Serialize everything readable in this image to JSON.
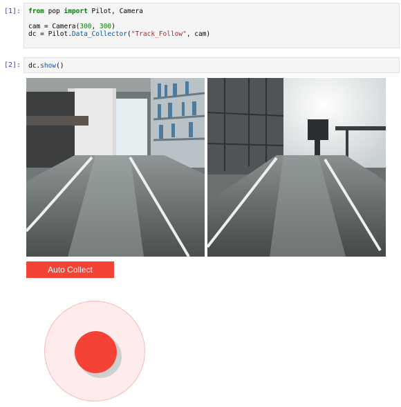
{
  "cells": [
    {
      "prompt": "[1]:",
      "code": {
        "line1": {
          "kw_from": "from",
          "mod": " pop ",
          "kw_import": "import",
          "names": " Pilot, Camera"
        },
        "line2": "",
        "line3": {
          "pre": "cam = Camera(",
          "n1": "300",
          "sep": ", ",
          "n2": "300",
          "post": ")"
        },
        "line4": {
          "pre": "dc = Pilot.",
          "attr": "Data_Collector",
          "open": "(",
          "str": "\"Track_Follow\"",
          "post": ", cam)"
        }
      }
    },
    {
      "prompt": "[2]:",
      "code": {
        "pre": "dc.",
        "attr": "show",
        "post": "()"
      }
    }
  ],
  "output": {
    "auto_collect_label": "Auto Collect",
    "colors": {
      "accent": "#f44336",
      "joystick_ring": "#fdeceb"
    }
  }
}
